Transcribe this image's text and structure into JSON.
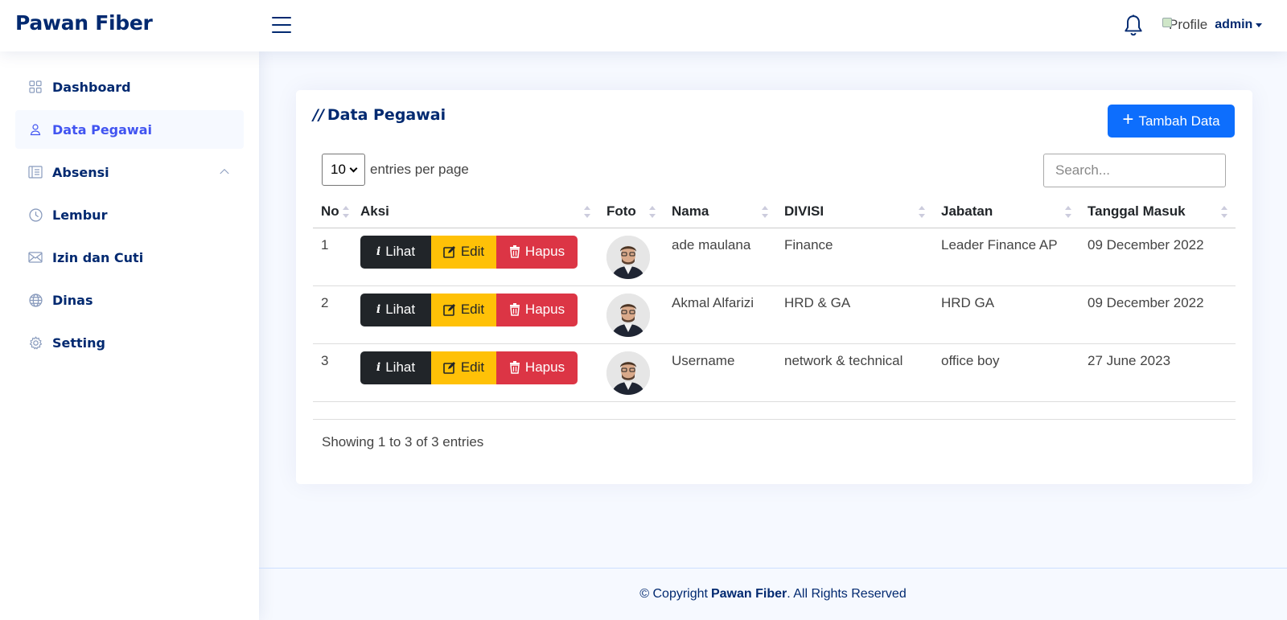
{
  "header": {
    "brand": "Pawan Fiber",
    "profile_alt": "Profile",
    "user_name": "admin"
  },
  "sidebar": {
    "items": [
      {
        "label": "Dashboard",
        "icon": "grid-icon"
      },
      {
        "label": "Data Pegawai",
        "icon": "person-icon"
      },
      {
        "label": "Absensi",
        "icon": "journal-icon"
      },
      {
        "label": "Lembur",
        "icon": "clock-icon"
      },
      {
        "label": "Izin dan Cuti",
        "icon": "envelope-icon"
      },
      {
        "label": "Dinas",
        "icon": "globe-icon"
      },
      {
        "label": "Setting",
        "icon": "gear-icon"
      }
    ]
  },
  "card": {
    "title_prefix": "//",
    "title": "Data Pegawai",
    "add_label": "Tambah Data",
    "per_page_value": "10",
    "per_page_label": "entries per page",
    "search_placeholder": "Search...",
    "columns": [
      "No",
      "Aksi",
      "Foto",
      "Nama",
      "DIVISI",
      "Jabatan",
      "Tanggal Masuk"
    ],
    "actions": {
      "view": "Lihat",
      "edit": "Edit",
      "delete": "Hapus"
    },
    "rows": [
      {
        "no": "1",
        "nama": "ade maulana",
        "divisi": "Finance",
        "jabatan": "Leader Finance AP",
        "tanggal": "09 December 2022"
      },
      {
        "no": "2",
        "nama": "Akmal Alfarizi",
        "divisi": "HRD & GA",
        "jabatan": "HRD GA",
        "tanggal": "09 December 2022"
      },
      {
        "no": "3",
        "nama": "Username",
        "divisi": "network & technical",
        "jabatan": "office boy",
        "tanggal": "27 June 2023"
      }
    ],
    "showing": "Showing 1 to 3 of 3 entries"
  },
  "footer": {
    "prefix": "© Copyright",
    "brand": "Pawan Fiber",
    "suffix": ". All Rights Reserved"
  },
  "colors": {
    "brand": "#012970",
    "accent": "#4154f1",
    "primary": "#0d6efd",
    "warning": "#ffc107",
    "danger": "#dc3545",
    "dark": "#212529"
  }
}
